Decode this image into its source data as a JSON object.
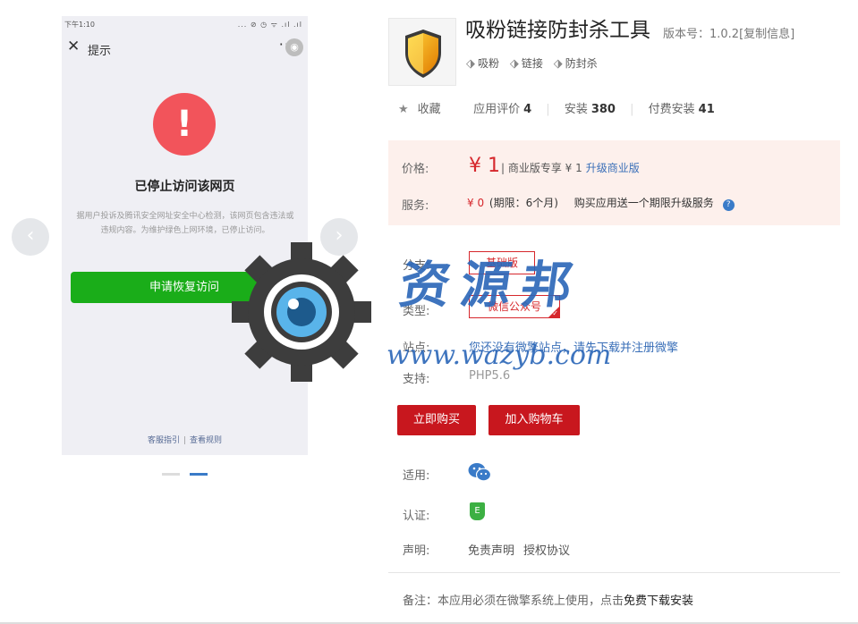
{
  "phone": {
    "status_time": "下午1:10",
    "status_icons": "... ⊘ ◷ ᯤ .ıl .ıl",
    "nav_title": "提示",
    "alert_mark": "!",
    "heading": "已停止访问该网页",
    "description": "据用户投诉及腾讯安全网址安全中心检测，该网页包含违法或违规内容。为维护绿色上网环境，已停止访问。",
    "button": "申请恢复访问",
    "footer_link1": "客服指引",
    "footer_sep": "|",
    "footer_link2": "查看规则"
  },
  "carousel": {
    "prev_arrow": "‹",
    "next_arrow": "›",
    "slide_count": 2,
    "active_slide": 2
  },
  "watermark": {
    "text_cn": "资源邦",
    "url": "www.wazyb.com"
  },
  "app": {
    "title": "吸粉链接防封杀工具",
    "version": "版本号：1.0.2[复制信息]",
    "tags": [
      "吸粉",
      "链接",
      "防封杀"
    ]
  },
  "stats": {
    "favorite": "收藏",
    "rating_label": "应用评价",
    "rating_value": "4",
    "install_label": "安装",
    "install_value": "380",
    "paid_label": "付费安装",
    "paid_value": "41"
  },
  "pricing": {
    "price_label": "价格:",
    "price": "¥ 1",
    "pro_note": "| 商业版专享 ¥ 1",
    "upgrade_link": "升级商业版",
    "service_label": "服务:",
    "service_price": "¥ 0",
    "service_period": "(期限：6个月)",
    "service_note": "购买应用送一个期限升级服务",
    "help": "?"
  },
  "details": {
    "branch_label": "分支:",
    "branch_value": "基础版",
    "type_label": "类型:",
    "type_value": "微信公众号",
    "site_label": "站点:",
    "site_value": "您还没有微擎站点，请先下载并注册微擎",
    "support_label": "支持:",
    "support_value": "PHP5.6"
  },
  "actions": {
    "buy": "立即购买",
    "cart": "加入购物车"
  },
  "extra": {
    "applies_label": "适用:",
    "cert_label": "认证:",
    "cert_icon_text": "E",
    "declare_label": "声明:",
    "disclaimer": "免责声明",
    "license": "授权协议",
    "note_prefix": "备注：本应用必须在微擎系统上使用，点击",
    "note_link": "免费下载安装"
  },
  "colors": {
    "brand_red": "#c8171e",
    "price_red": "#d6272c",
    "link_blue": "#3a6fb8",
    "price_bg": "#fdf0ec",
    "wechat_green": "#1aad19"
  }
}
